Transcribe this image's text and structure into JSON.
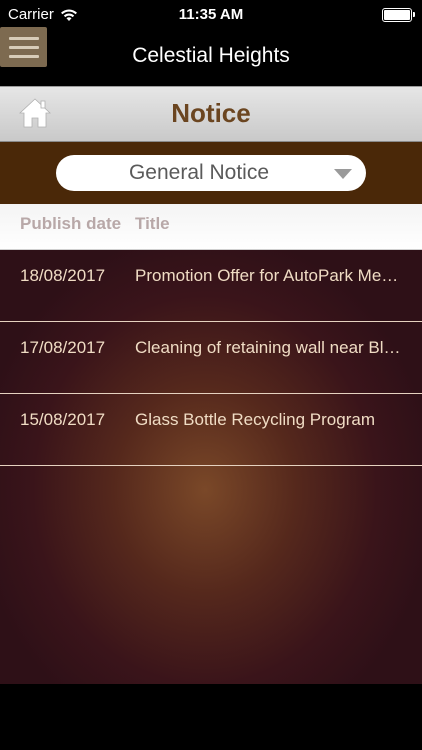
{
  "status_bar": {
    "carrier": "Carrier",
    "time": "11:35 AM"
  },
  "nav": {
    "title": "Celestial Heights"
  },
  "header": {
    "title": "Notice"
  },
  "dropdown": {
    "selected": "General Notice"
  },
  "table": {
    "columns": {
      "date": "Publish date",
      "title": "Title"
    },
    "rows": [
      {
        "date": "18/08/2017",
        "title": "Promotion Offer for AutoPark Members"
      },
      {
        "date": "17/08/2017",
        "title": "Cleaning of retaining wall near Block"
      },
      {
        "date": "15/08/2017",
        "title": "Glass Bottle Recycling Program"
      }
    ]
  },
  "colors": {
    "accent": "#6b4520",
    "strip": "#4a2808",
    "row_text": "#f0dcc4"
  }
}
